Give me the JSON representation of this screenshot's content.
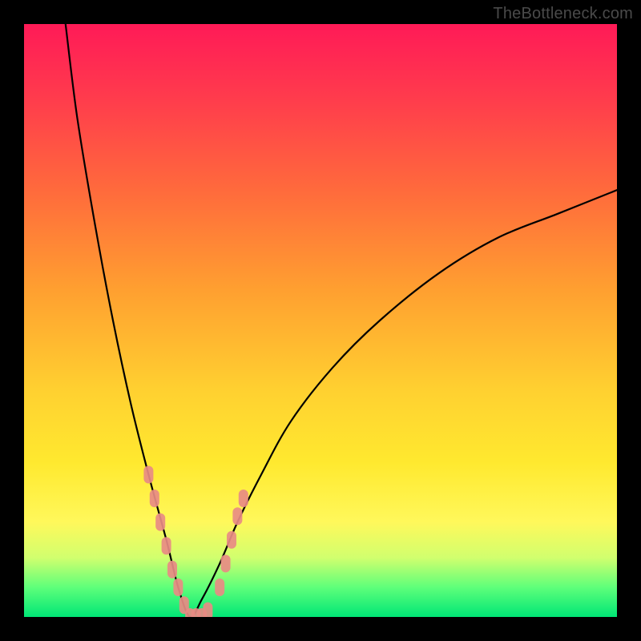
{
  "watermark": "TheBottleneck.com",
  "chart_data": {
    "type": "line",
    "title": "",
    "xlabel": "",
    "ylabel": "",
    "xlim": [
      0,
      100
    ],
    "ylim": [
      0,
      100
    ],
    "curve": {
      "name": "bottleneck-curve",
      "color": "#000000",
      "note": "V-shaped curve; minimum at x≈28, y≈0. Left branch rises steeply to y=100 at x≈7; right branch rises gently to y≈72 at x=100.",
      "x": [
        7,
        9,
        12,
        15,
        18,
        21,
        24,
        26,
        28,
        30,
        33,
        36,
        40,
        45,
        52,
        60,
        70,
        80,
        90,
        100
      ],
      "y": [
        100,
        84,
        66,
        50,
        36,
        24,
        13,
        5,
        0,
        3,
        9,
        16,
        24,
        33,
        42,
        50,
        58,
        64,
        68,
        72
      ]
    },
    "markers": {
      "name": "highlighted-points",
      "color": "#e88b84",
      "shape": "rounded-pill",
      "note": "Salmon-colored markers clustered near the bottom of the V.",
      "points": [
        {
          "x": 21,
          "y": 24
        },
        {
          "x": 22,
          "y": 20
        },
        {
          "x": 23,
          "y": 16
        },
        {
          "x": 24,
          "y": 12
        },
        {
          "x": 25,
          "y": 8
        },
        {
          "x": 26,
          "y": 5
        },
        {
          "x": 27,
          "y": 2
        },
        {
          "x": 28,
          "y": 0
        },
        {
          "x": 29,
          "y": 0
        },
        {
          "x": 30,
          "y": 0
        },
        {
          "x": 31,
          "y": 1
        },
        {
          "x": 33,
          "y": 5
        },
        {
          "x": 34,
          "y": 9
        },
        {
          "x": 35,
          "y": 13
        },
        {
          "x": 36,
          "y": 17
        },
        {
          "x": 37,
          "y": 20
        }
      ]
    },
    "gradient_stops": [
      {
        "pos": 0,
        "color": "#ff1a57"
      },
      {
        "pos": 12,
        "color": "#ff3a4d"
      },
      {
        "pos": 28,
        "color": "#ff6a3c"
      },
      {
        "pos": 45,
        "color": "#ffa030"
      },
      {
        "pos": 62,
        "color": "#ffd130"
      },
      {
        "pos": 74,
        "color": "#ffe92f"
      },
      {
        "pos": 84,
        "color": "#fff85b"
      },
      {
        "pos": 90,
        "color": "#d1ff6e"
      },
      {
        "pos": 95,
        "color": "#5eff7a"
      },
      {
        "pos": 100,
        "color": "#00e676"
      }
    ]
  }
}
